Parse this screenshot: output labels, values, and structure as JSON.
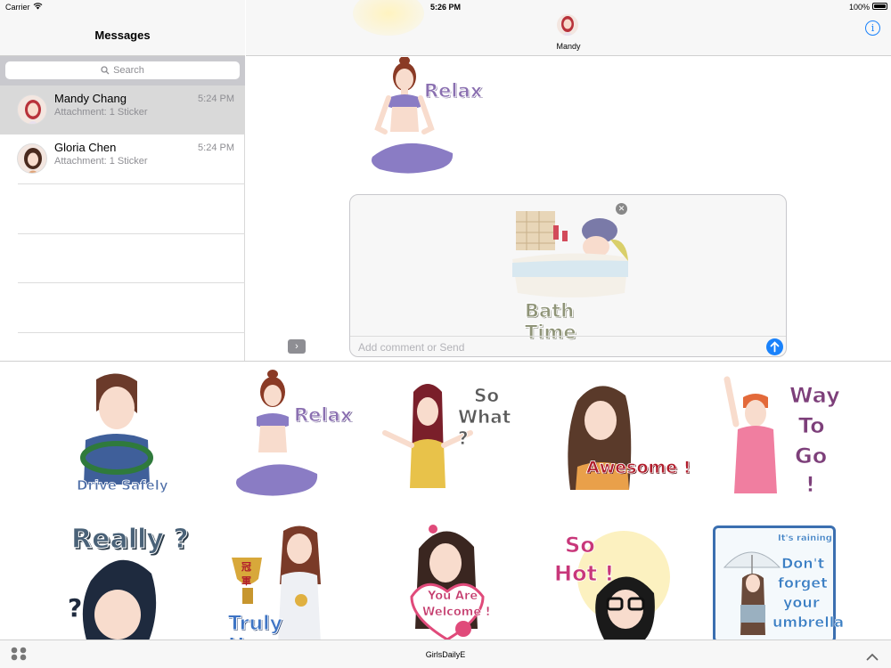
{
  "status": {
    "carrier": "Carrier",
    "time": "5:26 PM",
    "battery": "100%"
  },
  "sidebar": {
    "title": "Messages",
    "search_placeholder": "Search",
    "conversations": [
      {
        "name": "Mandy Chang",
        "preview": "Attachment: 1 Sticker",
        "time": "5:24 PM",
        "selected": true
      },
      {
        "name": "Gloria Chen",
        "preview": "Attachment: 1 Sticker",
        "time": "5:24 PM",
        "selected": false
      }
    ]
  },
  "chat": {
    "contact_name": "Mandy",
    "sent_sticker_caption": "Relax",
    "pending_sticker_caption": "Bath Time",
    "compose_placeholder": "Add comment or Send"
  },
  "drawer": {
    "stickers": [
      {
        "name": "drive-safely",
        "caption": "Drive Safely",
        "color": "#4f6fa8"
      },
      {
        "name": "relax",
        "caption": "Relax",
        "color": "#8a6fb0"
      },
      {
        "name": "so-what",
        "caption_lines": [
          "So",
          "What ?"
        ],
        "color": "#5b5b5b"
      },
      {
        "name": "awesome",
        "caption": "Awesome !",
        "color": "#b01c2b"
      },
      {
        "name": "way-to-go",
        "caption_lines": [
          "Way",
          "To",
          "Go",
          "!"
        ],
        "color": "#7d3f7a"
      },
      {
        "name": "really",
        "caption": "Really ?",
        "color": "#4a6278"
      },
      {
        "name": "truly-happy",
        "caption": "Truly Happy",
        "color": "#3e74c4"
      },
      {
        "name": "you-are-welcome",
        "caption_lines": [
          "You Are",
          "Welcome !"
        ],
        "color": "#c43a6c"
      },
      {
        "name": "so-hot",
        "caption_lines": [
          "So",
          "Hot !"
        ],
        "color": "#c8377a"
      },
      {
        "name": "umbrella",
        "caption_lines": [
          "It's raining",
          "Don't",
          "forget",
          "your",
          "umbrella"
        ],
        "color": "#3b7fc4"
      }
    ]
  },
  "bottom": {
    "pack_name": "GirlsDailyE"
  },
  "colors": {
    "accent": "#1a82fb",
    "selected_row": "#d9d9d9"
  }
}
